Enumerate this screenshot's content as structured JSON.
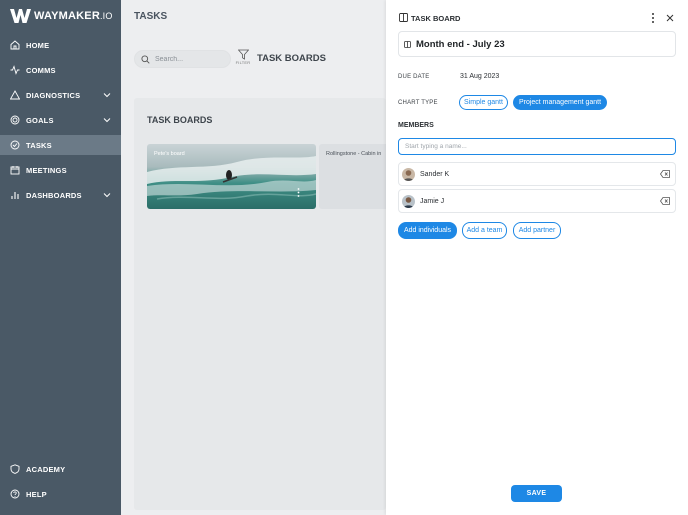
{
  "app": {
    "logo_text": "WAYMAKER",
    "logo_suffix": ".IO"
  },
  "sidebar": {
    "items": [
      {
        "label": "HOME",
        "icon": "home-icon"
      },
      {
        "label": "COMMS",
        "icon": "pulse-icon"
      },
      {
        "label": "DIAGNOSTICS",
        "icon": "triangle-icon",
        "expandable": true
      },
      {
        "label": "GOALS",
        "icon": "target-icon",
        "expandable": true
      },
      {
        "label": "TASKS",
        "icon": "check-circle-icon",
        "active": true
      },
      {
        "label": "MEETINGS",
        "icon": "calendar-icon"
      },
      {
        "label": "DASHBOARDS",
        "icon": "bar-chart-icon",
        "expandable": true
      }
    ],
    "bottom_items": [
      {
        "label": "ACADEMY",
        "icon": "shield-icon"
      },
      {
        "label": "HELP",
        "icon": "help-icon"
      }
    ]
  },
  "main": {
    "title": "TASKS",
    "search_placeholder": "Search...",
    "filter_label": "FILTER",
    "section_header": "TASK BOARDS",
    "panel_title": "TASK BOARDS",
    "boards": [
      {
        "label": "Pete's board"
      },
      {
        "label": "Rollingstone - Cabin in"
      }
    ]
  },
  "task_board_panel": {
    "header": "TASK BOARD",
    "name": "Month end - July 23",
    "due_date_label": "DUE DATE",
    "due_date_value": "31 Aug 2023",
    "chart_type_label": "CHART TYPE",
    "chart_types": [
      {
        "label": "Simple gantt",
        "selected": false
      },
      {
        "label": "Project management gantt",
        "selected": true
      }
    ],
    "members_label": "MEMBERS",
    "member_input_placeholder": "Start typing a name...",
    "members": [
      {
        "name": "Sander K"
      },
      {
        "name": "Jamie J"
      }
    ],
    "add_buttons": [
      {
        "label": "Add individuals",
        "style": "solid"
      },
      {
        "label": "Add a team",
        "style": "outline"
      },
      {
        "label": "Add partner",
        "style": "outline"
      }
    ],
    "save_label": "SAVE"
  },
  "colors": {
    "sidebar_bg": "#4a5966",
    "sidebar_active": "#6b7a87",
    "accent": "#1e88e5"
  }
}
